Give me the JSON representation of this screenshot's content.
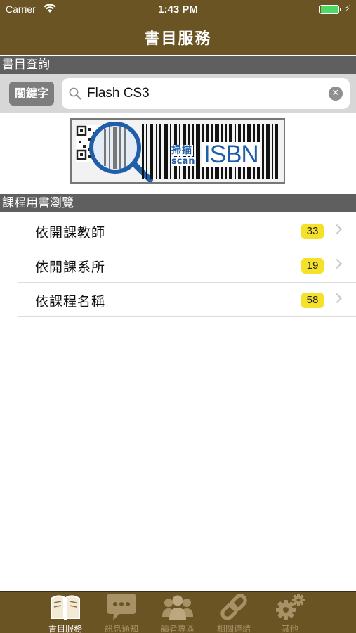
{
  "status_bar": {
    "carrier": "Carrier",
    "time": "1:43 PM",
    "battery_color": "#4cd964"
  },
  "nav": {
    "title": "書目服務"
  },
  "search_section": {
    "header": "書目查詢",
    "keyword_button": "關鍵字",
    "search_value": "Flash CS3",
    "scan": {
      "label_cn": "掃描",
      "label_en": "scan",
      "label_isbn": "ISBN"
    }
  },
  "course_section": {
    "header": "課程用書瀏覽",
    "items": [
      {
        "label": "依開課教師",
        "count": "33"
      },
      {
        "label": "依開課系所",
        "count": "19"
      },
      {
        "label": "依課程名稱",
        "count": "58"
      }
    ]
  },
  "tabs": [
    {
      "label": "書目服務",
      "icon": "book-icon",
      "active": true
    },
    {
      "label": "訊息通知",
      "icon": "speech-bubble-icon",
      "active": false
    },
    {
      "label": "讀者專區",
      "icon": "people-icon",
      "active": false
    },
    {
      "label": "相關連結",
      "icon": "link-icon",
      "active": false
    },
    {
      "label": "其他",
      "icon": "gears-icon",
      "active": false
    }
  ],
  "colors": {
    "brand": "#6b5424",
    "section_header": "#5f5f5f",
    "badge": "#f6e12a",
    "isbn_blue": "#1f5ea8"
  }
}
